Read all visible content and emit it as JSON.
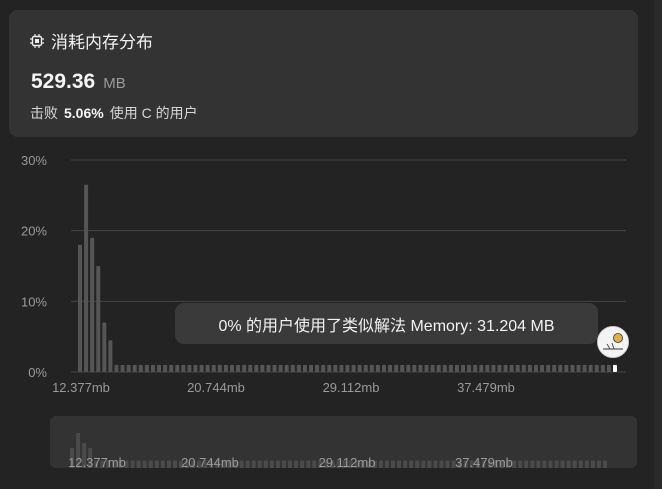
{
  "card": {
    "title": "消耗内存分布",
    "icon": "chip-icon",
    "value": "529.36",
    "unit": "MB",
    "beat_label": "击败",
    "beat_percent": "5.06%",
    "beat_suffix": "使用 C 的用户"
  },
  "tooltip": {
    "text": "0% 的用户使用了类似解法 Memory: 31.204 MB"
  },
  "colors": {
    "bar": "#555555",
    "grid": "#444444",
    "axis_text": "#9a9a9a",
    "highlight": "#ffffff"
  },
  "chart_data": {
    "type": "bar",
    "title": "",
    "xlabel": "",
    "ylabel": "",
    "ylim": [
      0,
      30
    ],
    "y_ticks": [
      "0%",
      "10%",
      "20%",
      "30%"
    ],
    "x_ticks": [
      "12.377mb",
      "20.744mb",
      "29.112mb",
      "37.479mb"
    ],
    "grid": true,
    "values": [
      18,
      26.5,
      19,
      15,
      7,
      4.5,
      1,
      1,
      1,
      1,
      1,
      1,
      1,
      1,
      1,
      1,
      1,
      1,
      1,
      1,
      1,
      1,
      1,
      1,
      1,
      1,
      1,
      1,
      1,
      1,
      1,
      1,
      1,
      1,
      1,
      1,
      1,
      1,
      1,
      1,
      1,
      1,
      1,
      1,
      1,
      1,
      1,
      1,
      1,
      1,
      1,
      1,
      1,
      1,
      1,
      1,
      1,
      1,
      1,
      1,
      1,
      1,
      1,
      1,
      1,
      1,
      1,
      1,
      1,
      1,
      1,
      1,
      1,
      1,
      1,
      1,
      1,
      1,
      1,
      1,
      1,
      1,
      1,
      1,
      1,
      1,
      1,
      1,
      1
    ],
    "highlight_index": 88,
    "mini_values": [
      4,
      7,
      5,
      4,
      1.5,
      1.5,
      1.5,
      1.5,
      1.5,
      1.5,
      1.5,
      1.5,
      1.5,
      1.5,
      1.5,
      1.5,
      1.5,
      1.5,
      1.5,
      1.5,
      1.5,
      1.5,
      1.5,
      1.5,
      1.5,
      1.5,
      1.5,
      1.5,
      1.5,
      1.5,
      1.5,
      1.5,
      1.5,
      1.5,
      1.5,
      1.5,
      1.5,
      1.5,
      1.5,
      1.5,
      1.5,
      1.5,
      1.5,
      1.5,
      1.5,
      1.5,
      1.5,
      1.5,
      1.5,
      1.5,
      1.5,
      1.5,
      1.5,
      1.5,
      1.5,
      1.5,
      1.5,
      1.5,
      1.5,
      1.5,
      1.5,
      1.5,
      1.5,
      1.5,
      1.5,
      1.5,
      1.5,
      1.5,
      1.5,
      1.5,
      1.5,
      1.5,
      1.5,
      1.5,
      1.5,
      1.5,
      1.5,
      1.5,
      1.5,
      1.5,
      1.5,
      1.5,
      1.5,
      1.5,
      1.5,
      1.5,
      1.5,
      1.5,
      1.5
    ]
  }
}
